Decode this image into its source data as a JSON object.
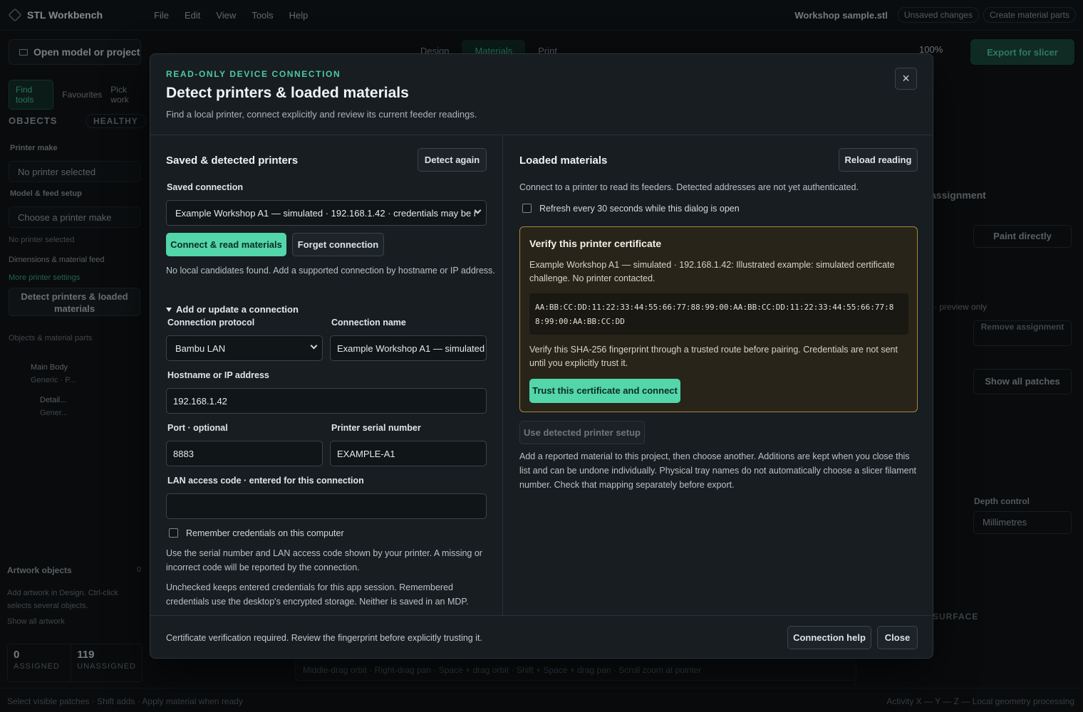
{
  "app": {
    "name": "STL Workbench",
    "menus": [
      "File",
      "Edit",
      "View",
      "Tools",
      "Help"
    ],
    "file_name": "Workshop sample.stl",
    "unsaved": "Unsaved changes",
    "create_parts": "Create material parts",
    "open_label": "Open model or project",
    "mode_tabs": [
      "Design",
      "Materials",
      "Print"
    ],
    "zoom": "100%",
    "export_label": "Export for slicer"
  },
  "left_panel": {
    "tabs": [
      "Find tools",
      "Favourites",
      "Pick work"
    ],
    "objects_title": "OBJECTS",
    "healthy": "HEALTHY",
    "printer_make_label": "Printer make",
    "printer_make_value": "No printer selected",
    "model_feed_label": "Model & feed setup",
    "model_feed_value": "Choose a printer make",
    "no_printer": "No printer selected",
    "dimensions": "Dimensions & material feed",
    "more_settings": "More printer settings",
    "detect_button": "Detect printers & loaded materials",
    "objects_parts": "Objects & material parts",
    "main_body": "Main Body",
    "main_body_sub": "Generic · P...",
    "detail": "Detail...",
    "detail_sub": "Gener...",
    "artwork_title": "Artwork objects",
    "artwork_count": "0",
    "artwork_hint": "Add artwork in Design. Ctrl-click selects several objects.",
    "show_all_artwork": "Show all artwork",
    "assigned_num": "0",
    "assigned_label": "ASSIGNED",
    "unassigned_num": "119",
    "unassigned_label": "UNASSIGNED"
  },
  "right_panel": {
    "assignment": "assignment",
    "paint_directly": "Paint directly",
    "preview_only": "· preview only",
    "remove_assignment": "Remove assignment",
    "show_all_patches": "Show all patches",
    "depth_control_label": "Depth control",
    "depth_control_value": "Millimetres",
    "surface_label": "SURFACE"
  },
  "hint_bar": "Middle-drag orbit · Right-drag pan · Space + drag orbit · Shift + Space + drag pan · Scroll zoom at pointer",
  "status_bar": {
    "left": "Select visible patches · Shift adds · Apply material when ready",
    "right": "Activity  X — Y — Z —    Local geometry processing"
  },
  "modal": {
    "eyebrow": "READ-ONLY DEVICE CONNECTION",
    "title": "Detect printers & loaded materials",
    "subtitle": "Find a local printer, connect explicitly and review its current feeder readings.",
    "close_glyph": "×",
    "left": {
      "heading": "Saved & detected printers",
      "detect_again": "Detect again",
      "saved_connection_label": "Saved connection",
      "saved_connection_value": "Example Workshop A1 — simulated · 192.168.1.42 · credentials may be r",
      "connect_button": "Connect & read materials",
      "forget_button": "Forget connection",
      "no_candidates": "No local candidates found. Add a supported connection by hostname or IP address.",
      "add_update": "Add or update a connection",
      "protocol_label": "Connection protocol",
      "protocol_value": "Bambu LAN",
      "name_label": "Connection name",
      "name_value": "Example Workshop A1 — simulated",
      "host_label": "Hostname or IP address",
      "host_value": "192.168.1.42",
      "port_label": "Port · optional",
      "port_value": "8883",
      "serial_label": "Printer serial number",
      "serial_value": "EXAMPLE-A1",
      "lan_label": "LAN access code · entered for this connection",
      "lan_value": "",
      "remember_label": "Remember credentials on this computer",
      "help_1": "Use the serial number and LAN access code shown by your printer. A missing or incorrect code will be reported by the connection.",
      "help_2": "Unchecked keeps entered credentials for this app session. Remembered credentials use the desktop's encrypted storage. Neither is saved in an MDP."
    },
    "right": {
      "heading": "Loaded materials",
      "reload_button": "Reload reading",
      "intro": "Connect to a printer to read its feeders. Detected addresses are not yet authenticated.",
      "refresh_label": "Refresh every 30 seconds while this dialog is open",
      "cert_title": "Verify this printer certificate",
      "cert_desc": "Example Workshop A1 — simulated · 192.168.1.42: Illustrated example: simulated certificate challenge. No printer contacted.",
      "fingerprint": "AA:BB:CC:DD:11:22:33:44:55:66:77:88:99:00:AA:BB:CC:DD:11:22:33:44:55:66:77:88:99:00:AA:BB:CC:DD",
      "cert_note": "Verify this SHA-256 fingerprint through a trusted route before pairing. Credentials are not sent until you explicitly trust it.",
      "trust_button": "Trust this certificate and connect",
      "use_detected": "Use detected printer setup",
      "add_note": "Add a reported material to this project, then choose another. Additions are kept when you close this list and can be undone individually. Physical tray names do not automatically choose a slicer filament number. Check that mapping separately before export."
    },
    "footer": {
      "status": "Certificate verification required. Review the fingerprint before explicitly trusting it.",
      "help_button": "Connection help",
      "close_button": "Close"
    }
  }
}
